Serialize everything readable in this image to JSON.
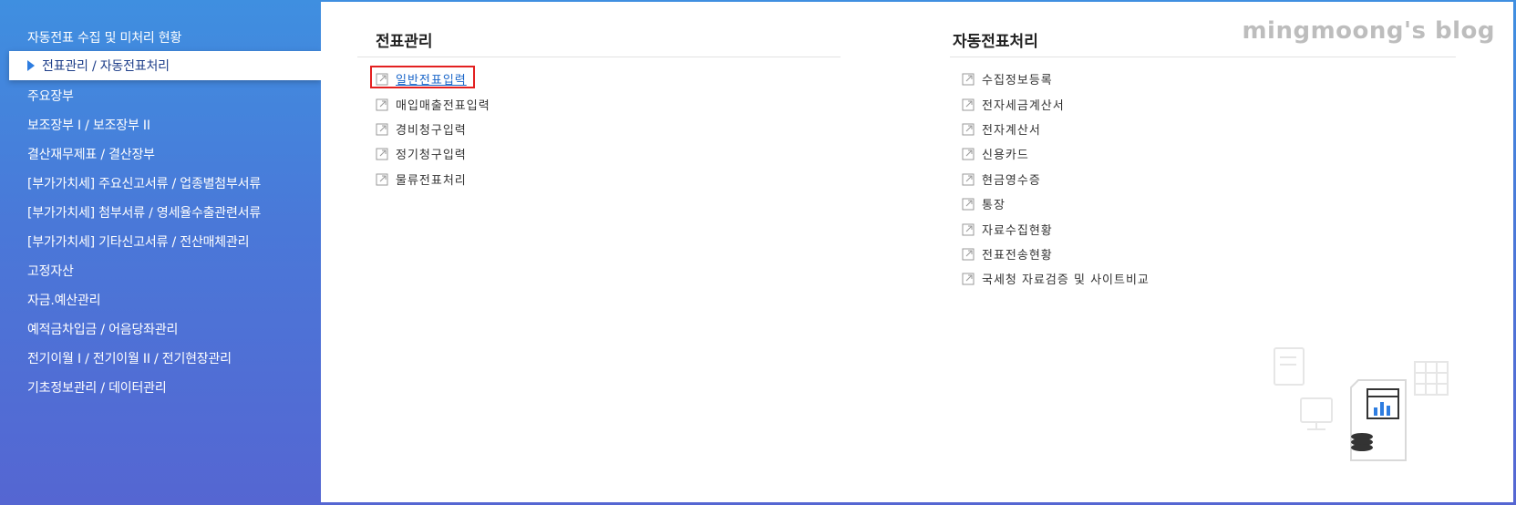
{
  "sidebar": {
    "items": [
      {
        "label": "자동전표 수집 및 미처리 현황"
      },
      {
        "label": "전표관리 / 자동전표처리"
      },
      {
        "label": "주요장부"
      },
      {
        "label": "보조장부 I / 보조장부 II"
      },
      {
        "label": "결산재무제표 / 결산장부"
      },
      {
        "label": "[부가가치세] 주요신고서류 / 업종별첨부서류"
      },
      {
        "label": "[부가가치세] 첨부서류 / 영세율수출관련서류"
      },
      {
        "label": "[부가가치세] 기타신고서류 / 전산매체관리"
      },
      {
        "label": "고정자산"
      },
      {
        "label": "자금.예산관리"
      },
      {
        "label": "예적금차입금 / 어음당좌관리"
      },
      {
        "label": "전기이월 I / 전기이월 II / 전기현장관리"
      },
      {
        "label": "기초정보관리 / 데이터관리"
      }
    ]
  },
  "left_column": {
    "title": "전표관리",
    "items": [
      "일반전표입력",
      "매입매출전표입력",
      "경비청구입력",
      "정기청구입력",
      "물류전표처리"
    ]
  },
  "right_column": {
    "title": "자동전표처리",
    "items": [
      "수집정보등록",
      "전자세금계산서",
      "전자계산서",
      "신용카드",
      "현금영수증",
      "통장",
      "자료수집현황",
      "전표전송현황",
      "국세청 자료검증 및 사이트비교"
    ]
  },
  "watermark": "mingmoong's blog",
  "colors": {
    "accent": "#2e7de0",
    "highlight_border": "#e32020",
    "link": "#1a66c9"
  }
}
